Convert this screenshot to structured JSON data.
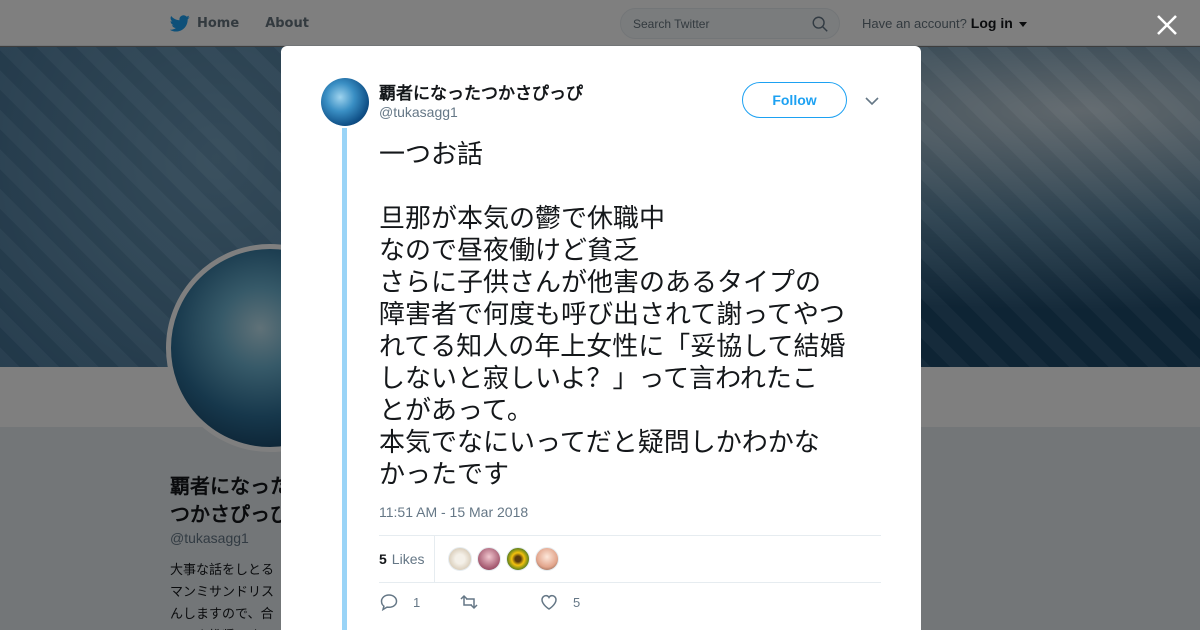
{
  "topbar": {
    "home_label": "Home",
    "about_label": "About",
    "search_placeholder": "Search Twitter",
    "account_prompt": "Have an account?",
    "login_label": "Log in"
  },
  "profile": {
    "name": "覇者になったつかさぴっぴ",
    "handle": "@tukasagg1",
    "bio": "大事な話をしとる\nマンミサンドリス\nんしますので、合\nロック推奨です"
  },
  "tweet": {
    "author_name": "覇者になったつかさぴっぴ",
    "author_handle": "@tukasagg1",
    "follow_label": "Follow",
    "text": "一つお話\n\n旦那が本気の鬱で休職中\nなので昼夜働けど貧乏\nさらに子供さんが他害のあるタイプの\n障害者で何度も呼び出されて謝ってやつ\nれてる知人の年上女性に「妥協して結婚\nしないと寂しいよ？」って言われたこ\nとがあって。\n本気でなにいってだと疑問しかわかな\nかったです",
    "timestamp": "11:51 AM - 15 Mar 2018",
    "likes_count": "5",
    "likes_label": "Likes",
    "reply_count": "1",
    "retweet_count": "",
    "like_count": "5"
  },
  "colors": {
    "accent": "#1da1f2",
    "thread_line": "#9ad4f7",
    "text_primary": "#14171a",
    "text_secondary": "#657786"
  }
}
